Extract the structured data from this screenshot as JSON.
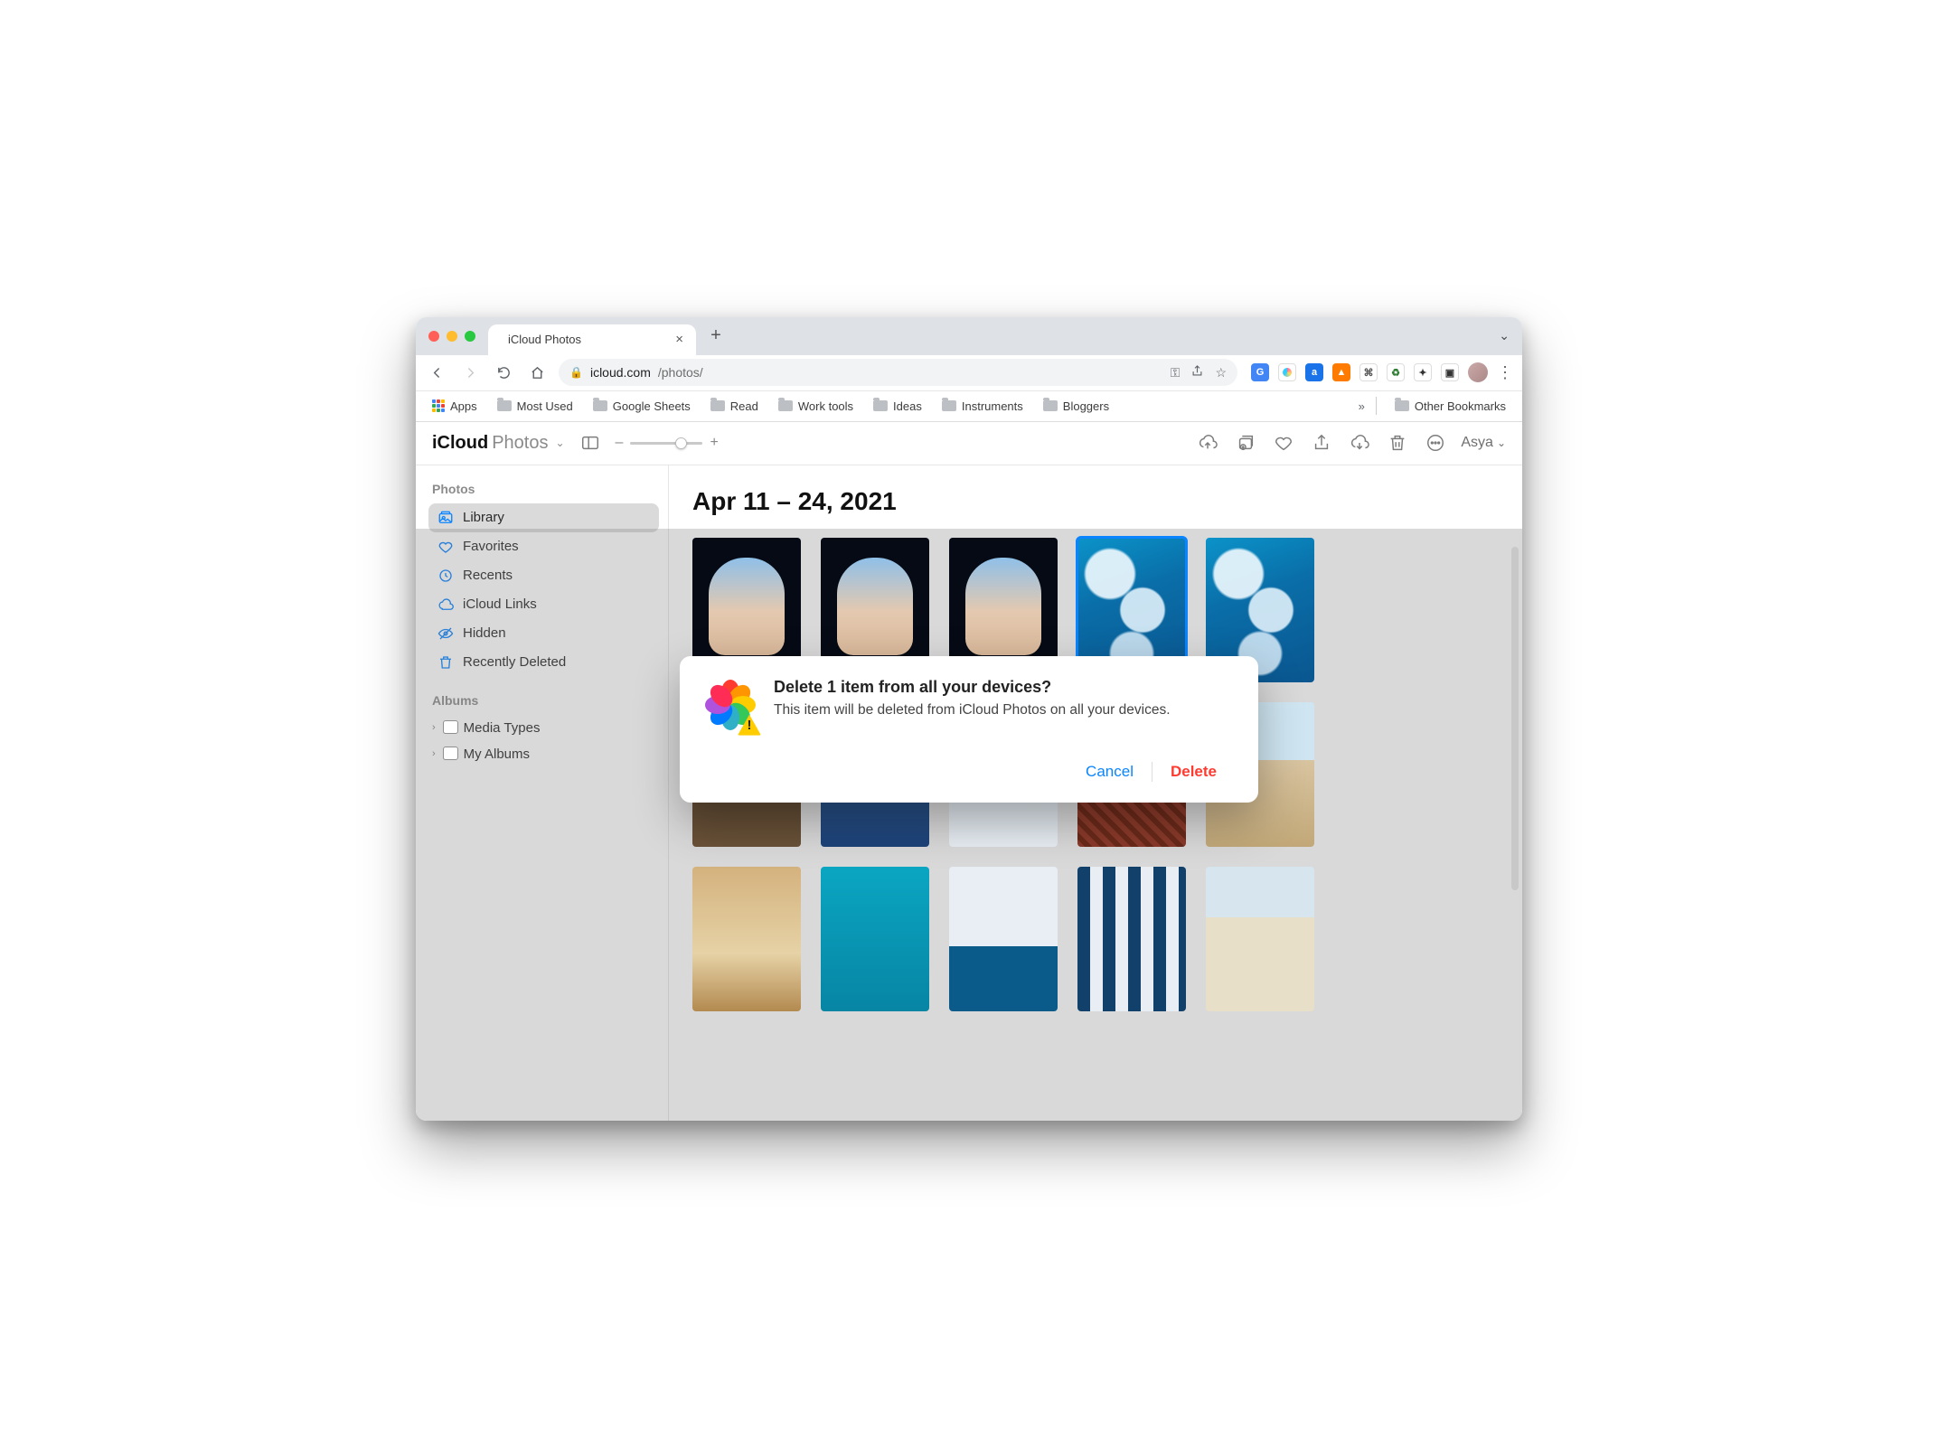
{
  "browser": {
    "tab_title": "iCloud Photos",
    "url_host": "icloud.com",
    "url_path": "/photos/",
    "bookmarks": {
      "apps": "Apps",
      "items": [
        "Most Used",
        "Google Sheets",
        "Read",
        "Work tools",
        "Ideas",
        "Instruments",
        "Bloggers"
      ],
      "other": "Other Bookmarks"
    }
  },
  "app": {
    "brand1": "iCloud",
    "brand2": "Photos",
    "user": "Asya"
  },
  "sidebar": {
    "photos_header": "Photos",
    "items": [
      {
        "label": "Library",
        "icon": "photos"
      },
      {
        "label": "Favorites",
        "icon": "heart"
      },
      {
        "label": "Recents",
        "icon": "clock"
      },
      {
        "label": "iCloud Links",
        "icon": "cloud"
      },
      {
        "label": "Hidden",
        "icon": "eye-off"
      },
      {
        "label": "Recently Deleted",
        "icon": "trash"
      }
    ],
    "albums_header": "Albums",
    "albums": [
      {
        "label": "Media Types"
      },
      {
        "label": "My Albums"
      }
    ]
  },
  "grid": {
    "header": "Apr 11 – 24, 2021"
  },
  "dialog": {
    "title": "Delete 1 item from all your devices?",
    "message": "This item will be deleted from iCloud Photos on all your devices.",
    "cancel": "Cancel",
    "delete": "Delete"
  },
  "zoom": {
    "minus": "–",
    "plus": "+"
  }
}
